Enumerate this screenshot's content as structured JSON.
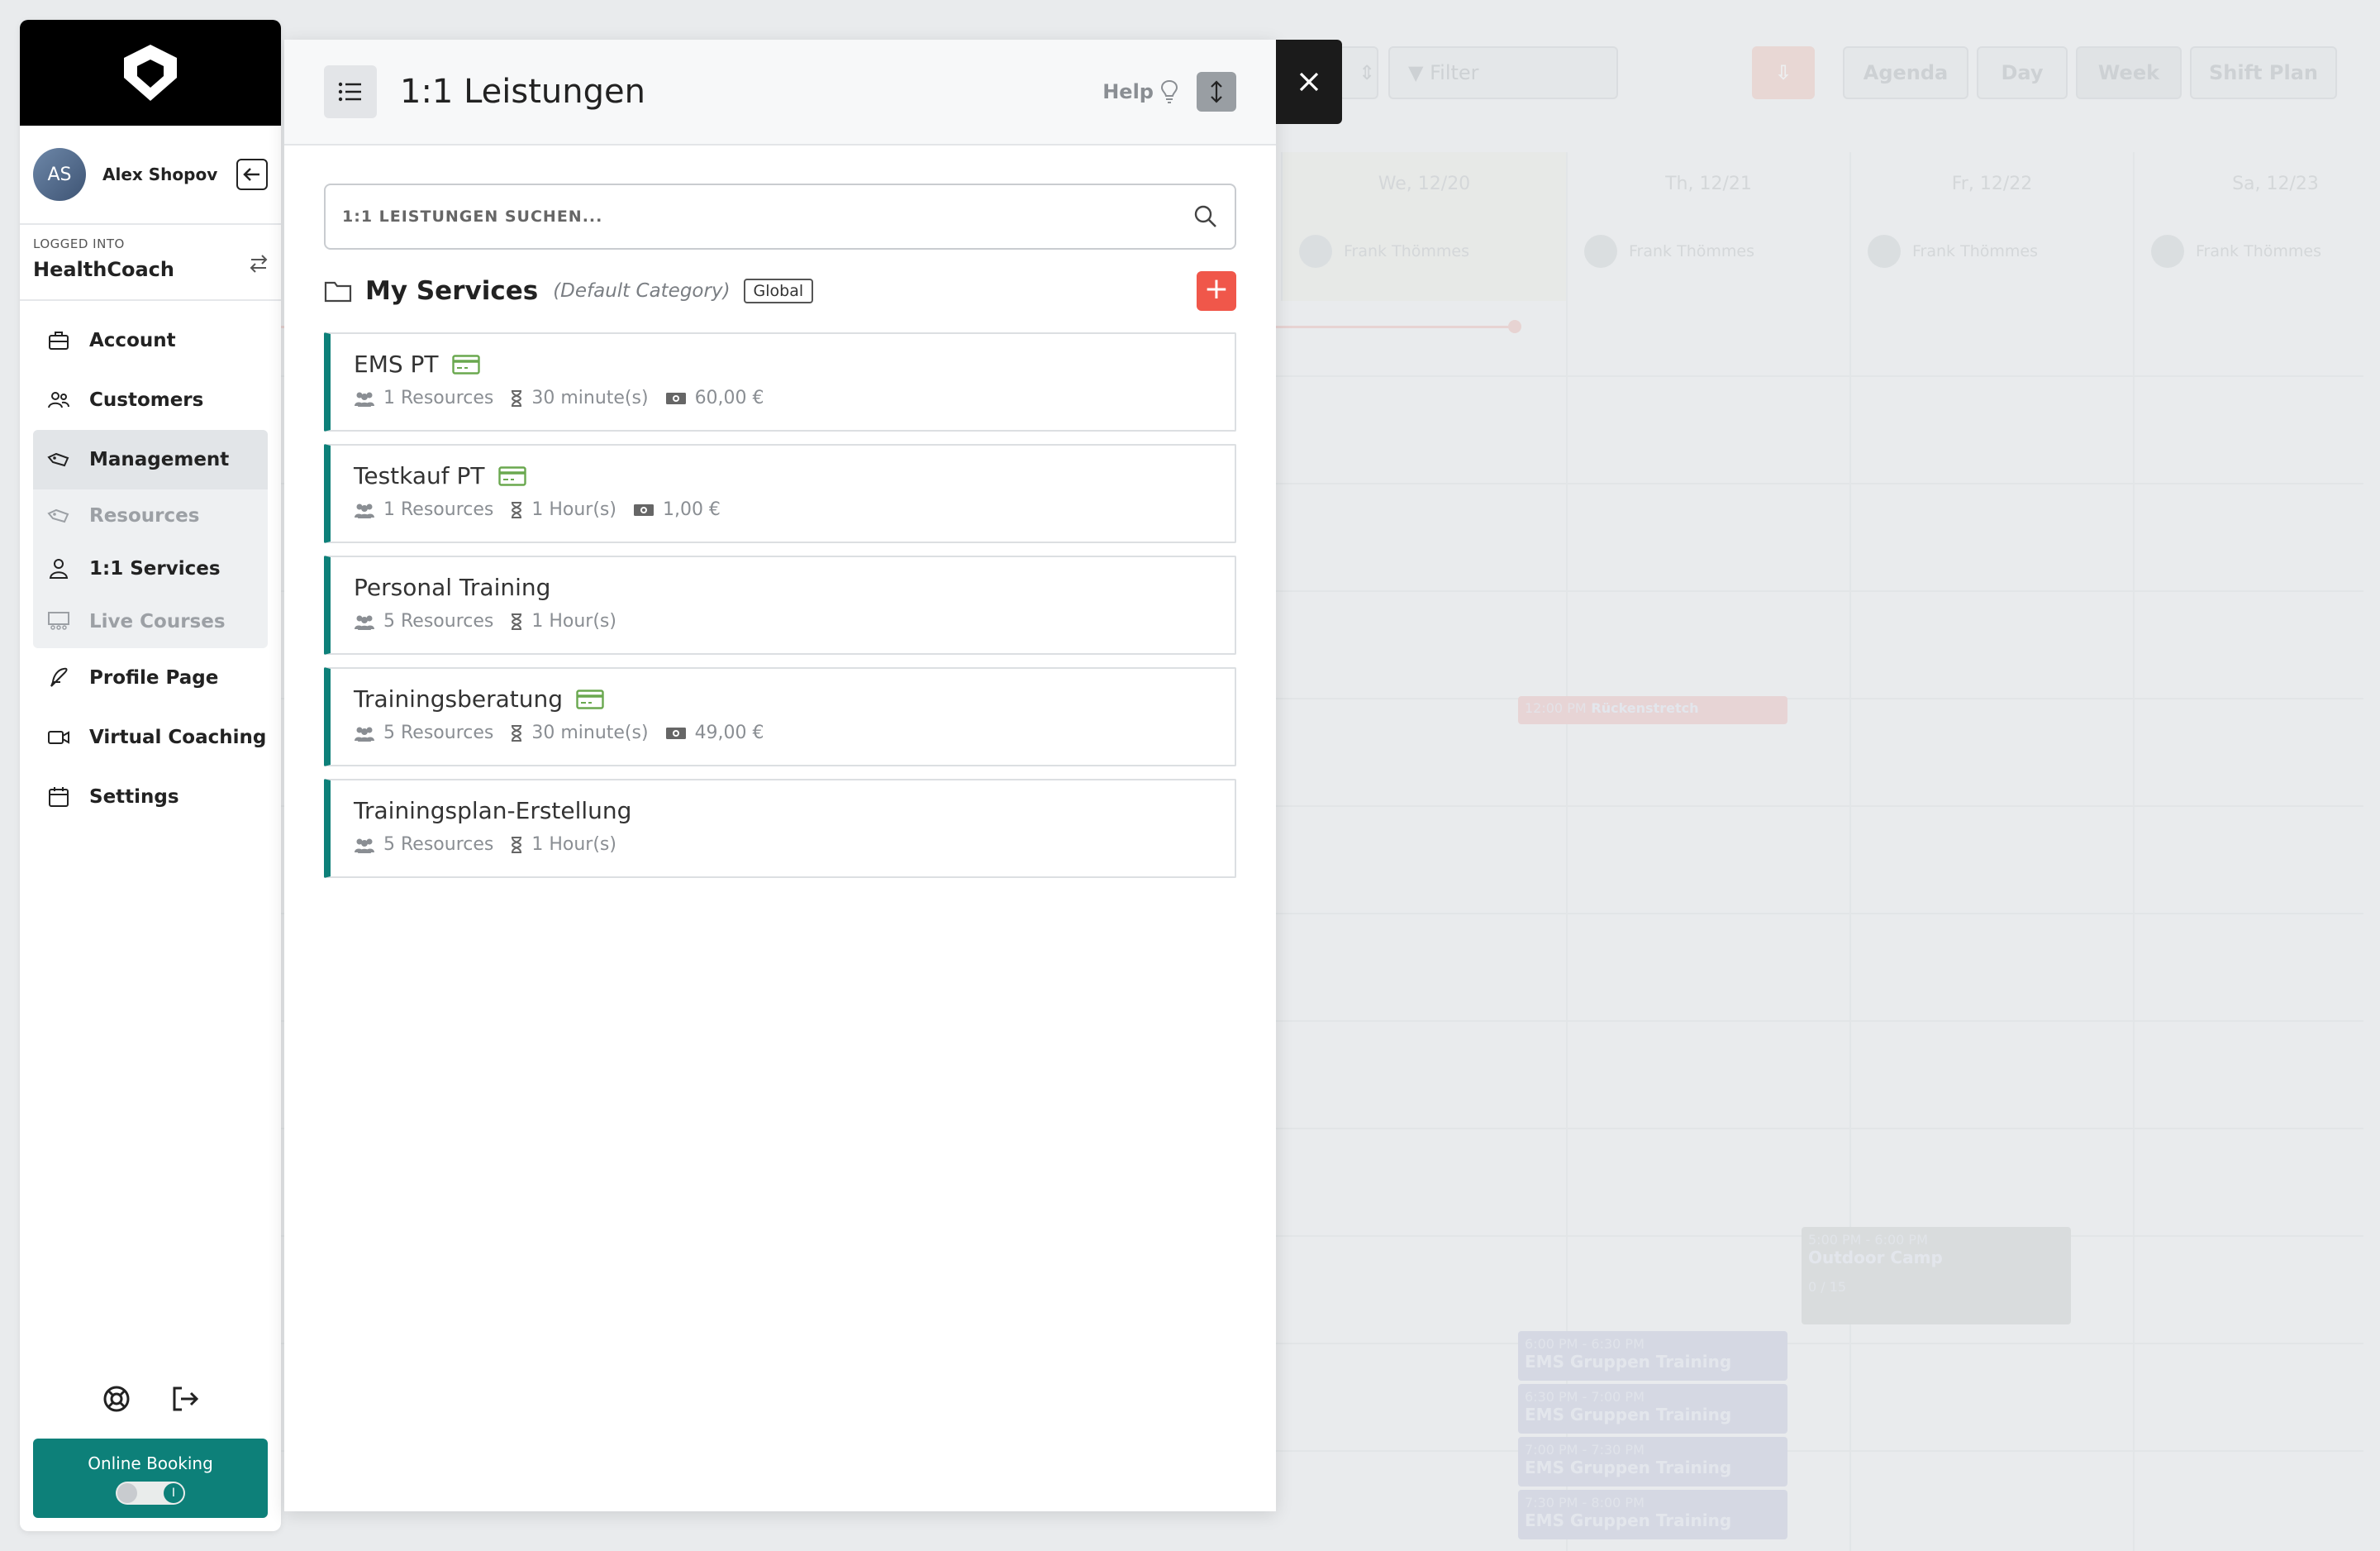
{
  "sidebar": {
    "user": {
      "initials": "AS",
      "name": "Alex Shopov"
    },
    "logged_into_caption": "LOGGED INTO",
    "org_name": "HealthCoach",
    "nav": {
      "account": "Account",
      "customers": "Customers",
      "management": "Management",
      "resources": "Resources",
      "services": "1:1 Services",
      "live_courses": "Live Courses",
      "profile_page": "Profile Page",
      "virtual_coaching": "Virtual Coaching",
      "settings": "Settings"
    },
    "online_booking": {
      "label": "Online Booking",
      "enabled": true,
      "toggle_glyph": "I"
    }
  },
  "panel": {
    "title": "1:1 Leistungen",
    "help_label": "Help",
    "search_placeholder": "1:1 LEISTUNGEN SUCHEN...",
    "category": {
      "title": "My Services",
      "default_label": "(Default Category)",
      "scope_badge": "Global",
      "add_glyph": "+"
    },
    "services": [
      {
        "name": "EMS PT",
        "card": true,
        "resources": "1 Resources",
        "duration": "30 minute(s)",
        "price": "60,00 €"
      },
      {
        "name": "Testkauf PT",
        "card": true,
        "resources": "1 Resources",
        "duration": "1 Hour(s)",
        "price": "1,00 €"
      },
      {
        "name": "Personal Training",
        "card": false,
        "resources": "5 Resources",
        "duration": "1 Hour(s)",
        "price": ""
      },
      {
        "name": "Trainingsberatung",
        "card": true,
        "resources": "5 Resources",
        "duration": "30 minute(s)",
        "price": "49,00 €"
      },
      {
        "name": "Trainingsplan-Erstellung",
        "card": false,
        "resources": "5 Resources",
        "duration": "1 Hour(s)",
        "price": ""
      }
    ]
  },
  "calendar": {
    "filter_placeholder": "Filter",
    "views": {
      "agenda": "Agenda",
      "day": "Day",
      "week": "Week",
      "shift_plan": "Shift Plan"
    },
    "days": [
      {
        "label": "We, 12/20",
        "person": "Frank Thömmes"
      },
      {
        "label": "Th, 12/21",
        "person": "Frank Thömmes"
      },
      {
        "label": "Fr, 12/22",
        "person": "Frank Thömmes"
      },
      {
        "label": "Sa, 12/23",
        "person": "Frank Thömmes"
      }
    ],
    "events": {
      "rueckenstretch": {
        "time": "12:00 PM",
        "name": "Rückenstretch"
      },
      "outdoor": {
        "time": "5:00 PM - 6:00 PM",
        "name": "Outdoor Camp",
        "count": "0 / 15"
      },
      "ems1": {
        "time": "6:00 PM - 6:30 PM",
        "name": "EMS Gruppen Training"
      },
      "ems2": {
        "time": "6:30 PM - 7:00 PM",
        "name": "EMS Gruppen Training"
      },
      "ems3": {
        "time": "7:00 PM - 7:30 PM",
        "name": "EMS Gruppen Training"
      },
      "ems4": {
        "time": "7:30 PM - 8:00 PM",
        "name": "EMS Gruppen Training"
      }
    }
  },
  "colors": {
    "accent_teal": "#0d8079",
    "add_red": "#f0574a",
    "card_green": "#6aa84f"
  }
}
